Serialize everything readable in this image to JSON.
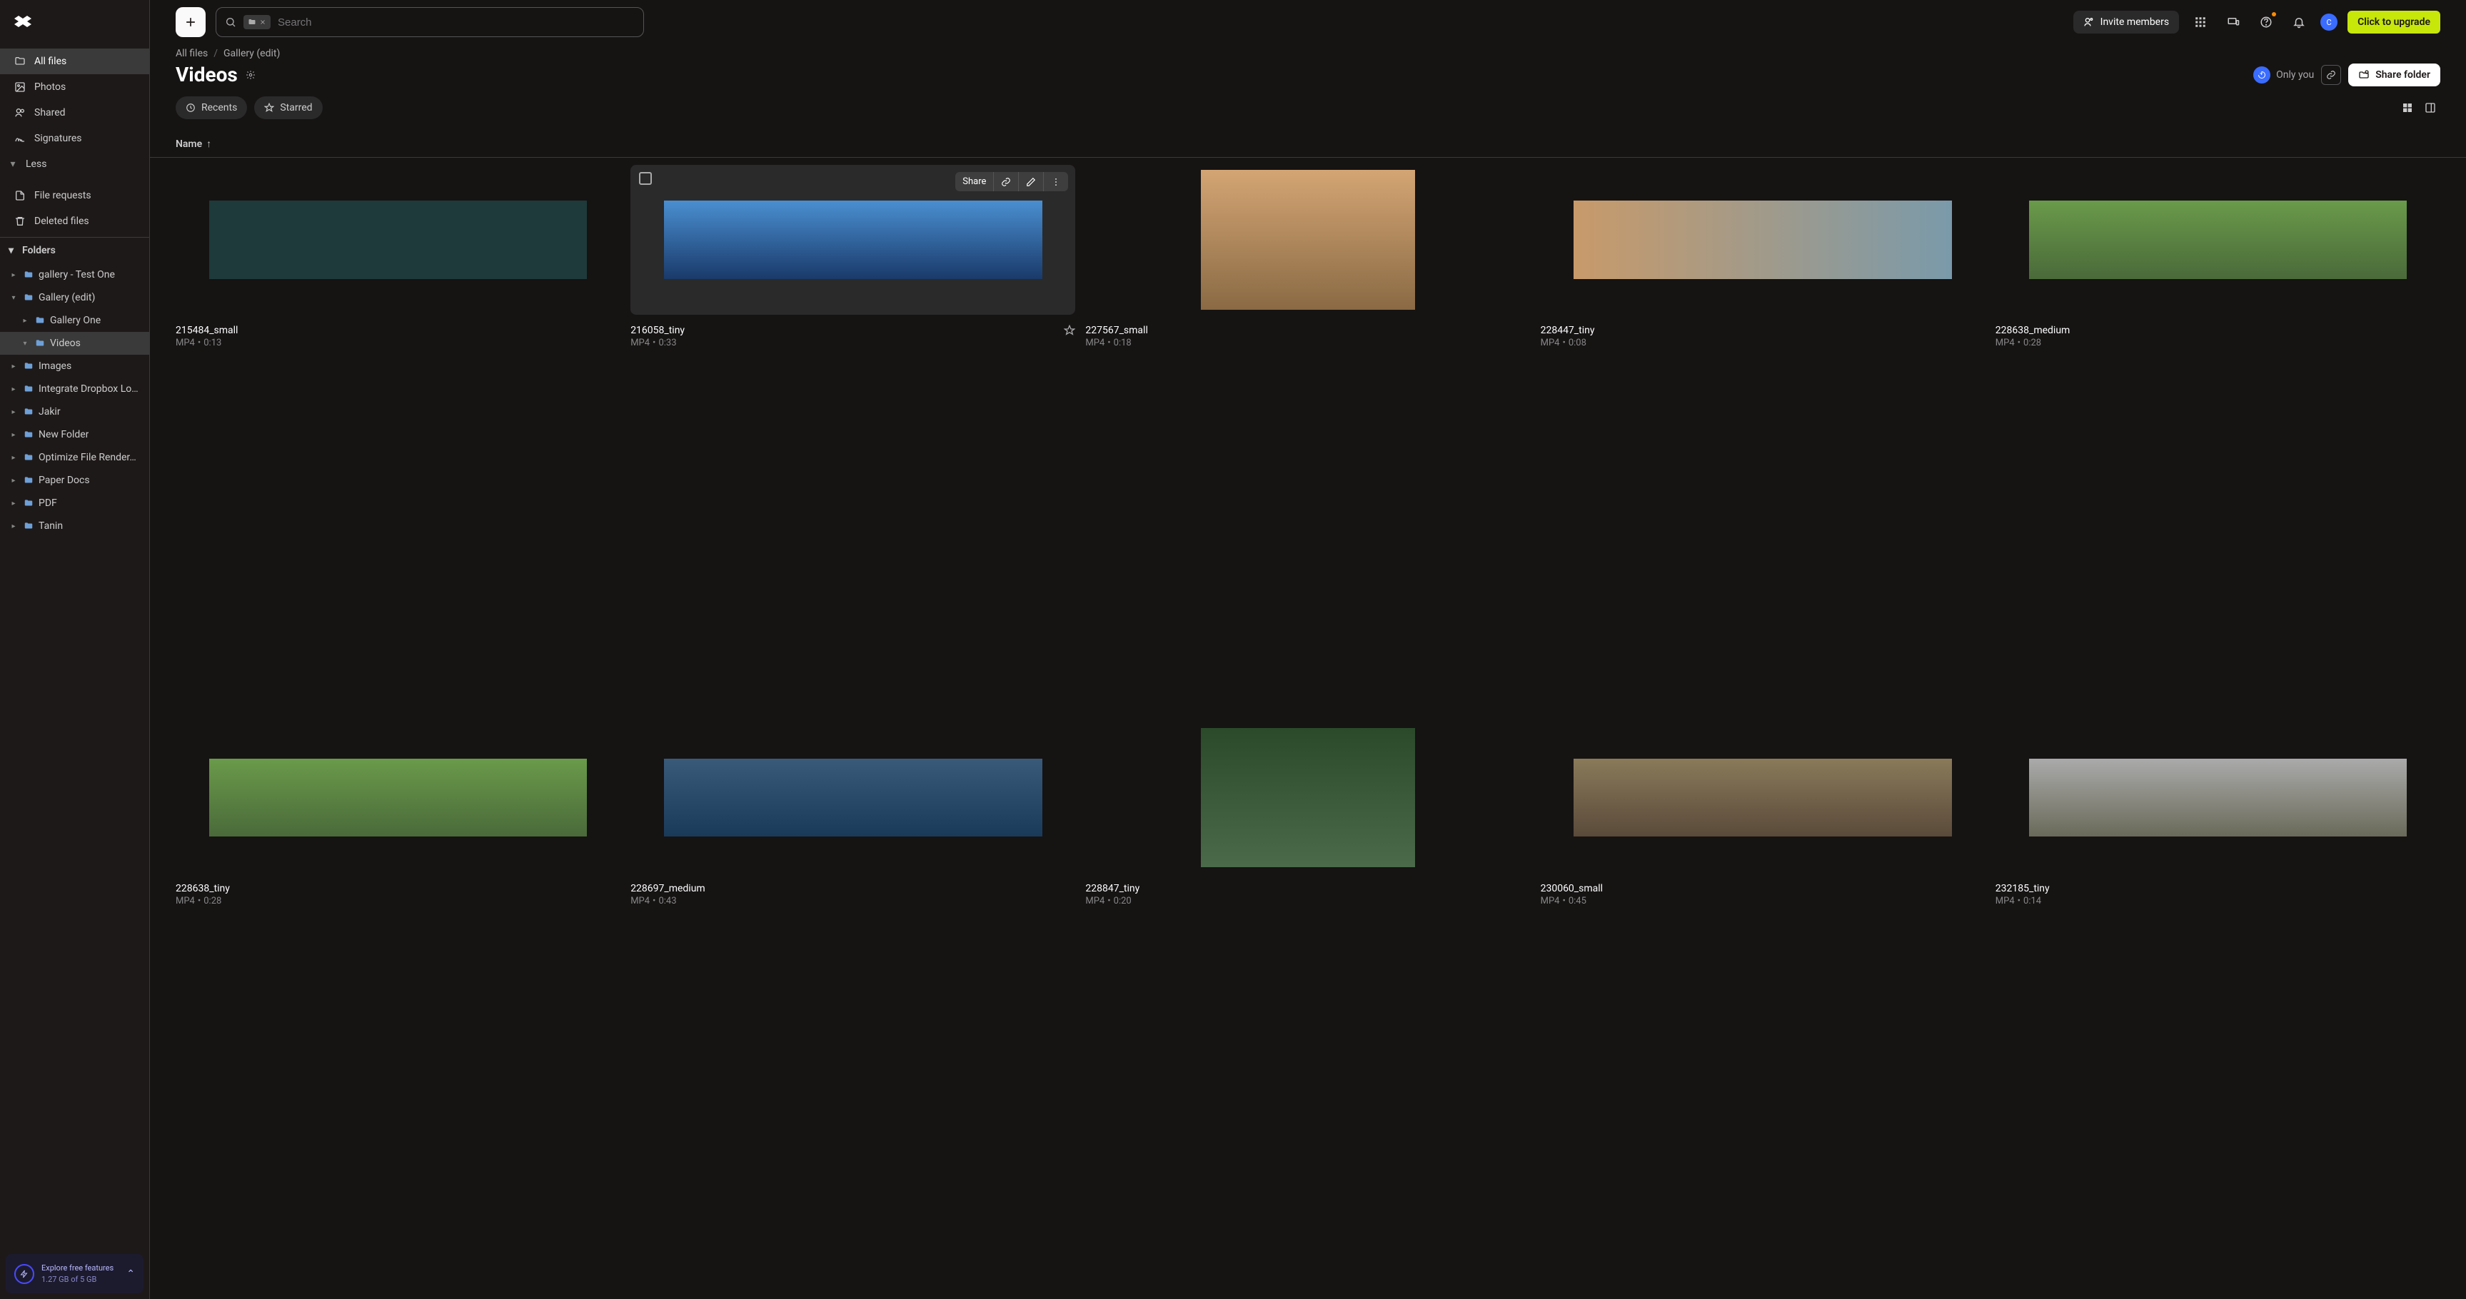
{
  "brand": {
    "name": "Dropbox"
  },
  "sidebar": {
    "nav": [
      {
        "label": "All files",
        "icon": "folder",
        "active": true
      },
      {
        "label": "Photos",
        "icon": "image"
      },
      {
        "label": "Shared",
        "icon": "people"
      },
      {
        "label": "Signatures",
        "icon": "signature"
      },
      {
        "label": "Less",
        "icon": "chevron"
      }
    ],
    "nav2": [
      {
        "label": "File requests",
        "icon": "file"
      },
      {
        "label": "Deleted files",
        "icon": "trash"
      }
    ],
    "folders_label": "Folders",
    "tree": [
      {
        "label": "gallery - Test One",
        "indent": 0,
        "expanded": false
      },
      {
        "label": "Gallery (edit)",
        "indent": 0,
        "expanded": true
      },
      {
        "label": "Gallery One",
        "indent": 1,
        "expanded": false
      },
      {
        "label": "Videos",
        "indent": 1,
        "expanded": true,
        "selected": true
      },
      {
        "label": "Images",
        "indent": 0,
        "expanded": false
      },
      {
        "label": "Integrate Dropbox Lo…",
        "indent": 0,
        "expanded": false
      },
      {
        "label": "Jakir",
        "indent": 0,
        "expanded": false
      },
      {
        "label": "New Folder",
        "indent": 0,
        "expanded": false
      },
      {
        "label": "Optimize File Render…",
        "indent": 0,
        "expanded": false
      },
      {
        "label": "Paper Docs",
        "indent": 0,
        "expanded": false
      },
      {
        "label": "PDF",
        "indent": 0,
        "expanded": false
      },
      {
        "label": "Tanin",
        "indent": 0,
        "expanded": false
      }
    ],
    "storage": {
      "title": "Explore free features",
      "sub": "1.27 GB of 5 GB"
    }
  },
  "header": {
    "search_placeholder": "Search",
    "invite_label": "Invite members",
    "upgrade_label": "Click to upgrade",
    "avatar_initial": "C"
  },
  "breadcrumb": {
    "parts": [
      "All files",
      "Gallery (edit)"
    ]
  },
  "folder": {
    "title": "Videos",
    "privacy": "Only you",
    "share_label": "Share folder"
  },
  "filters": {
    "recents": "Recents",
    "starred": "Starred"
  },
  "column_header": "Name",
  "hover_actions": {
    "share": "Share"
  },
  "files": [
    {
      "name": "215484_small",
      "type": "MP4",
      "dur": "0:13",
      "thumb": "#1e3a3a",
      "portrait": false,
      "hovered": false
    },
    {
      "name": "216058_tiny",
      "type": "MP4",
      "dur": "0:33",
      "thumb": "linear-gradient(#4a8fd1,#1a3a6a)",
      "portrait": false,
      "hovered": true
    },
    {
      "name": "227567_small",
      "type": "MP4",
      "dur": "0:18",
      "thumb": "linear-gradient(#d4a574,#8a6a44)",
      "portrait": true,
      "hovered": false
    },
    {
      "name": "228447_tiny",
      "type": "MP4",
      "dur": "0:08",
      "thumb": "linear-gradient(90deg,#c89a6a,#7a9aaa)",
      "portrait": false,
      "hovered": false
    },
    {
      "name": "228638_medium",
      "type": "MP4",
      "dur": "0:28",
      "thumb": "linear-gradient(#6a9a4a,#4a6a3a)",
      "portrait": false,
      "hovered": false
    },
    {
      "name": "228638_tiny",
      "type": "MP4",
      "dur": "0:28",
      "thumb": "linear-gradient(#6a9a4a,#4a6a3a)",
      "portrait": false,
      "hovered": false
    },
    {
      "name": "228697_medium",
      "type": "MP4",
      "dur": "0:43",
      "thumb": "linear-gradient(#3a5a7a,#1a3a5a)",
      "portrait": false,
      "hovered": false
    },
    {
      "name": "228847_tiny",
      "type": "MP4",
      "dur": "0:20",
      "thumb": "linear-gradient(#2a4a2a,#4a6a4a)",
      "portrait": true,
      "hovered": false
    },
    {
      "name": "230060_small",
      "type": "MP4",
      "dur": "0:45",
      "thumb": "linear-gradient(#8a7a5a,#5a4a3a)",
      "portrait": false,
      "hovered": false
    },
    {
      "name": "232185_tiny",
      "type": "MP4",
      "dur": "0:14",
      "thumb": "linear-gradient(#aaa,#6a6a5a)",
      "portrait": false,
      "hovered": false
    }
  ]
}
